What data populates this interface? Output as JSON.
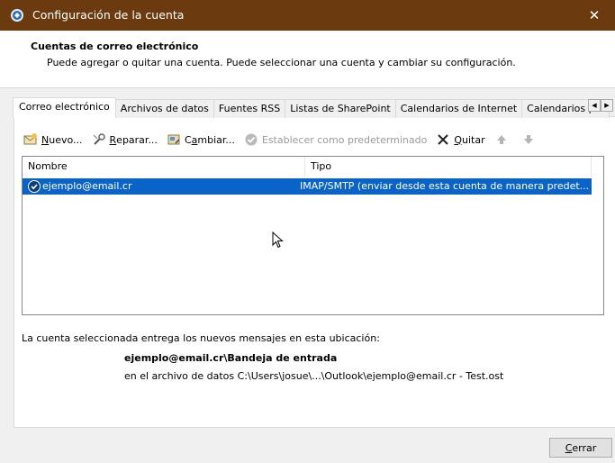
{
  "window": {
    "title": "Configuración de la cuenta",
    "close_glyph": "✕",
    "colors": {
      "titlebar": "#6b3a0e",
      "selection": "#0a63c6"
    }
  },
  "header": {
    "title": "Cuentas de correo electrónico",
    "subtitle": "Puede agregar o quitar una cuenta. Puede seleccionar una cuenta y cambiar su configuración."
  },
  "tabs": [
    {
      "label": "Correo electrónico",
      "active": true
    },
    {
      "label": "Archivos de datos"
    },
    {
      "label": "Fuentes RSS"
    },
    {
      "label": "Listas de SharePoint"
    },
    {
      "label": "Calendarios de Internet"
    },
    {
      "label": "Calendarios pul"
    }
  ],
  "tab_scroll": {
    "left": "◀",
    "right": "▶"
  },
  "toolbar": {
    "nuevo_underline": "N",
    "nuevo_rest": "uevo...",
    "reparar_underline": "R",
    "reparar_rest": "eparar...",
    "cambiar_pre": "C",
    "cambiar_underline": "a",
    "cambiar_rest": "mbiar...",
    "predeterminado_label": "Establecer como predeterminado",
    "quitar_underline": "Q",
    "quitar_rest": "uitar",
    "icons": [
      "new-account-icon",
      "repair-icon",
      "change-icon",
      "default-check-icon",
      "remove-x-icon",
      "up-arrow-icon",
      "down-arrow-icon"
    ]
  },
  "accounts_table": {
    "columns": [
      "Nombre",
      "Tipo"
    ],
    "rows": [
      {
        "name": "ejemplo@email.cr",
        "type": "IMAP/SMTP (enviar desde esta cuenta de manera predet..."
      }
    ]
  },
  "delivery": {
    "label": "La cuenta seleccionada entrega los nuevos mensajes en esta ubicación:",
    "folder": "ejemplo@email.cr\\Bandeja de entrada",
    "path": "en el archivo de datos C:\\Users\\josue\\...\\Outlook\\ejemplo@email.cr - Test.ost"
  },
  "footer": {
    "close_underline": "C",
    "close_rest": "errar"
  }
}
